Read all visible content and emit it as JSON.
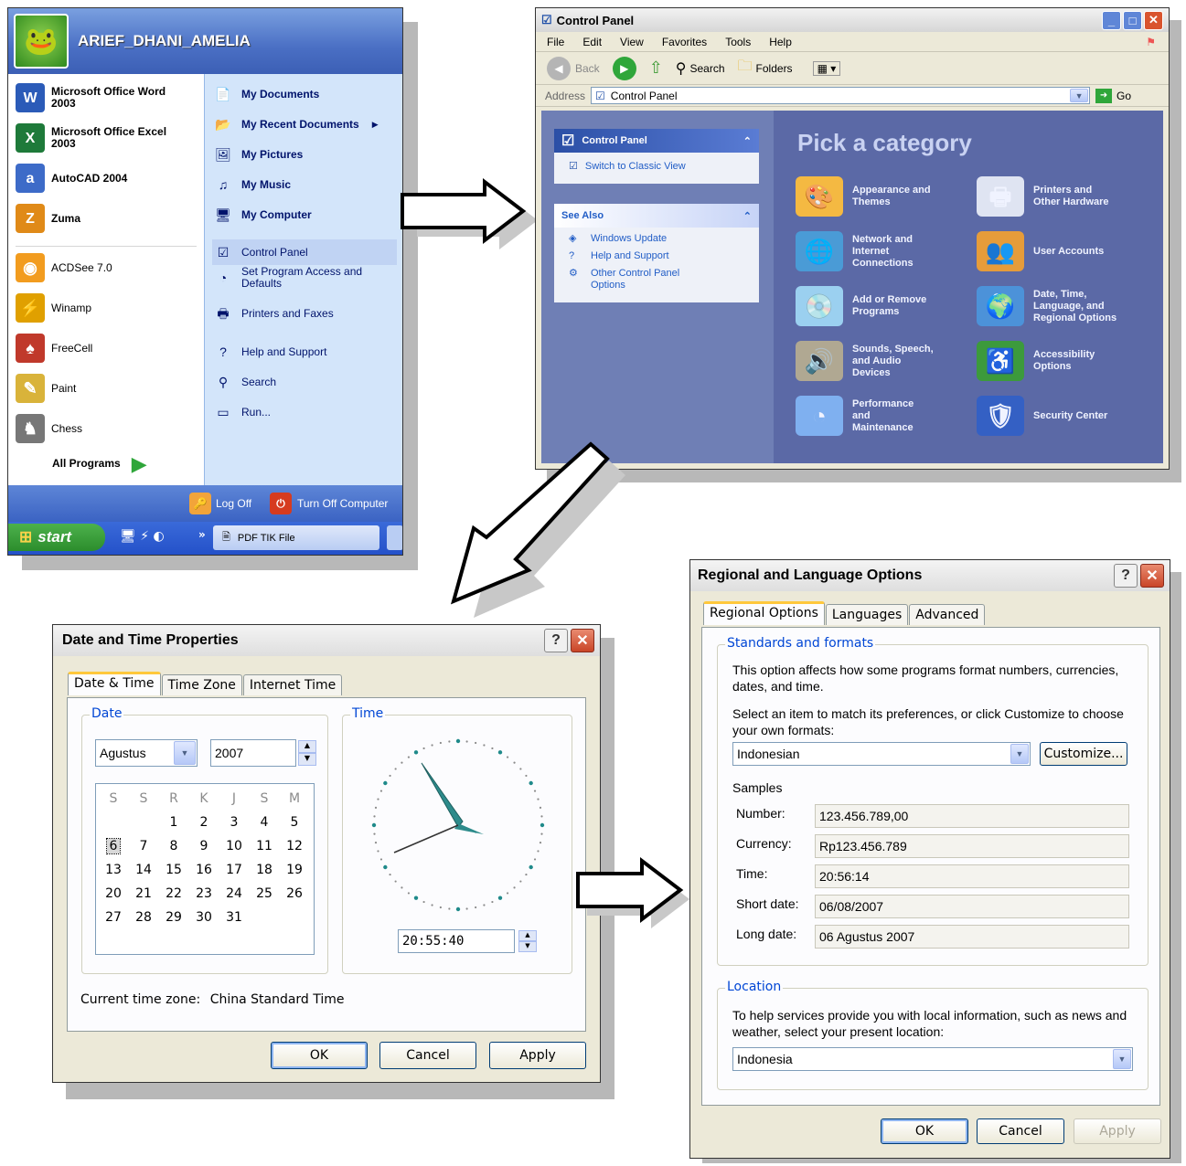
{
  "start_menu": {
    "user_name": "ARIEF_DHANI_AMELIA",
    "pinned": [
      {
        "label": "Microsoft Office Word\n2003",
        "icon": "word-icon",
        "color": "#2b5bb8",
        "glyph": "W"
      },
      {
        "label": "Microsoft Office Excel\n2003",
        "icon": "excel-icon",
        "color": "#1e7a3a",
        "glyph": "X"
      },
      {
        "label": "AutoCAD 2004",
        "icon": "autocad-icon",
        "color": "#3d6bc8",
        "glyph": "a"
      },
      {
        "label": "Zuma",
        "icon": "zuma-icon",
        "color": "#e08a18",
        "glyph": "Z"
      }
    ],
    "recent": [
      {
        "label": "ACDSee 7.0",
        "icon": "acdsee-icon",
        "color": "#f29c1f",
        "glyph": "◉"
      },
      {
        "label": "Winamp",
        "icon": "winamp-icon",
        "color": "#e0a000",
        "glyph": "⚡"
      },
      {
        "label": "FreeCell",
        "icon": "freecell-icon",
        "color": "#c0392b",
        "glyph": "♠"
      },
      {
        "label": "Paint",
        "icon": "paint-icon",
        "color": "#d9b33a",
        "glyph": "✎"
      },
      {
        "label": "Chess",
        "icon": "chess-icon",
        "color": "#777777",
        "glyph": "♞"
      }
    ],
    "all_programs": "All Programs",
    "right_items": [
      {
        "label": "My Documents",
        "bold": true,
        "icon": "my-documents-icon",
        "glyph": "📄"
      },
      {
        "label": "My Recent Documents",
        "bold": true,
        "icon": "recent-documents-icon",
        "glyph": "📂"
      },
      {
        "label": "My Pictures",
        "bold": true,
        "icon": "my-pictures-icon",
        "glyph": "🖼"
      },
      {
        "label": "My Music",
        "bold": true,
        "icon": "my-music-icon",
        "glyph": "♫"
      },
      {
        "label": "My Computer",
        "bold": true,
        "icon": "my-computer-icon",
        "glyph": "🖥"
      },
      {
        "label": "Control Panel",
        "bold": false,
        "icon": "control-panel-icon",
        "glyph": "☑"
      },
      {
        "label": "Set Program Access and\nDefaults",
        "bold": false,
        "icon": "program-access-icon",
        "glyph": "◔"
      },
      {
        "label": "Printers and Faxes",
        "bold": false,
        "icon": "printer-icon",
        "glyph": "🖶"
      },
      {
        "label": "Help and Support",
        "bold": false,
        "icon": "help-icon",
        "glyph": "?"
      },
      {
        "label": "Search",
        "bold": false,
        "icon": "search-icon",
        "glyph": "⚲"
      },
      {
        "label": "Run...",
        "bold": false,
        "icon": "run-icon",
        "glyph": "▭"
      }
    ],
    "log_off": "Log Off",
    "turn_off": "Turn Off Computer",
    "start_label": "start",
    "taskbar_item": "PDF TIK File",
    "taskbar_chevron": "»"
  },
  "control_panel": {
    "title": "Control Panel",
    "menu": [
      "File",
      "Edit",
      "View",
      "Favorites",
      "Tools",
      "Help"
    ],
    "toolbar": {
      "back": "Back",
      "search": "Search",
      "folders": "Folders"
    },
    "address_label": "Address",
    "address_value": "Control Panel",
    "go": "Go",
    "side_panel_title": "Control Panel",
    "switch_view": "Switch to Classic View",
    "see_also_title": "See Also",
    "see_also": [
      "Windows Update",
      "Help and Support",
      "Other Control Panel\nOptions"
    ],
    "heading": "Pick a category",
    "categories": [
      {
        "label": "Appearance and\nThemes",
        "icon": "appearance-icon",
        "glyph": "🎨"
      },
      {
        "label": "Printers and\nOther Hardware",
        "icon": "printer-hardware-icon",
        "glyph": "🖶"
      },
      {
        "label": "Network and\nInternet\nConnections",
        "icon": "network-icon",
        "glyph": "🌐"
      },
      {
        "label": "User Accounts",
        "icon": "user-accounts-icon",
        "glyph": "👥"
      },
      {
        "label": "Add or Remove\nPrograms",
        "icon": "add-remove-icon",
        "glyph": "💿"
      },
      {
        "label": "Date, Time,\nLanguage, and\nRegional Options",
        "icon": "date-time-icon",
        "glyph": "🌍"
      },
      {
        "label": "Sounds, Speech,\nand Audio\nDevices",
        "icon": "sounds-icon",
        "glyph": "🔊"
      },
      {
        "label": "Accessibility\nOptions",
        "icon": "accessibility-icon",
        "glyph": "♿"
      },
      {
        "label": "Performance\nand\nMaintenance",
        "icon": "performance-icon",
        "glyph": "◔"
      },
      {
        "label": "Security Center",
        "icon": "security-icon",
        "glyph": "🛡"
      }
    ]
  },
  "date_time": {
    "title": "Date and Time Properties",
    "tabs": [
      "Date & Time",
      "Time Zone",
      "Internet Time"
    ],
    "date_group": "Date",
    "month": "Agustus",
    "year": "2007",
    "weekdays": [
      "S",
      "S",
      "R",
      "K",
      "J",
      "S",
      "M"
    ],
    "weeks": [
      [
        "",
        "",
        "1",
        "2",
        "3",
        "4",
        "5"
      ],
      [
        "6",
        "7",
        "8",
        "9",
        "10",
        "11",
        "12"
      ],
      [
        "13",
        "14",
        "15",
        "16",
        "17",
        "18",
        "19"
      ],
      [
        "20",
        "21",
        "22",
        "23",
        "24",
        "25",
        "26"
      ],
      [
        "27",
        "28",
        "29",
        "30",
        "31",
        "",
        ""
      ]
    ],
    "selected_day": "6",
    "time_group": "Time",
    "time": "20:55:40",
    "timezone_label": "Current time zone:",
    "timezone_value": "China Standard Time",
    "ok": "OK",
    "cancel": "Cancel",
    "apply": "Apply"
  },
  "regional": {
    "title": "Regional and Language Options",
    "tabs": [
      "Regional Options",
      "Languages",
      "Advanced"
    ],
    "standards_group": "Standards and formats",
    "desc1": "This option affects how some programs format numbers, currencies, dates, and time.",
    "desc2": "Select an item to match its preferences, or click Customize to choose your own formats:",
    "format_value": "Indonesian",
    "customize": "Customize...",
    "samples_label": "Samples",
    "samples": [
      {
        "label": "Number:",
        "value": "123.456.789,00"
      },
      {
        "label": "Currency:",
        "value": "Rp123.456.789"
      },
      {
        "label": "Time:",
        "value": "20:56:14"
      },
      {
        "label": "Short date:",
        "value": "06/08/2007"
      },
      {
        "label": "Long date:",
        "value": "06 Agustus 2007"
      }
    ],
    "location_group": "Location",
    "location_desc": "To help services provide you with local information, such as news and weather, select your present location:",
    "location_value": "Indonesia",
    "ok": "OK",
    "cancel": "Cancel",
    "apply": "Apply"
  }
}
